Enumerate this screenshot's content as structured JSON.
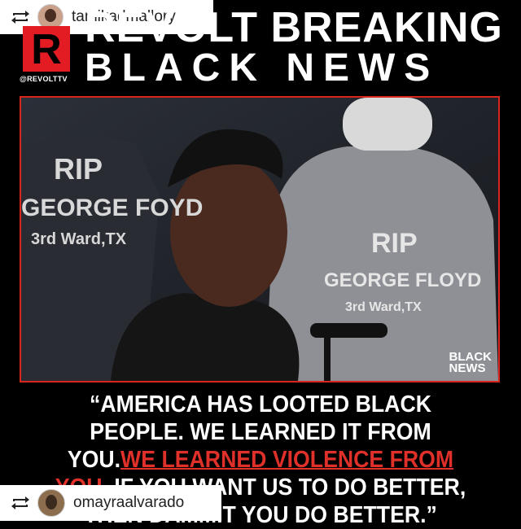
{
  "reposts": {
    "top_username": "tamikadmallory",
    "bottom_username": "omayraalvarado"
  },
  "header": {
    "logo_letter": "R",
    "handle": "@REVOLTTV",
    "headline_line1": "REVOLT BREAKING",
    "headline_line2": "BLACK NEWS"
  },
  "video": {
    "hoodie_text_left": [
      "RIP",
      "GEORGE FOYD",
      "3rd Ward,TX"
    ],
    "hoodie_text_right": [
      "RIP",
      "GEORGE FLOYD",
      "3rd Ward,TX"
    ],
    "watermark_line1": "BLACK",
    "watermark_line2": "NEWS"
  },
  "quote": {
    "part1": "“AMERICA HAS LOOTED BLACK PEOPLE. WE LEARNED IT FROM YOU.",
    "part2_red": "WE LEARNED VIOLENCE FROM YOU.",
    "part3": " IF YOU WANT US TO DO BETTER, THEN DAMMIT YOU DO BETTER.”"
  },
  "colors": {
    "accent_red": "#e31b23",
    "border_red": "#d9261c",
    "text": "#ffffff"
  }
}
